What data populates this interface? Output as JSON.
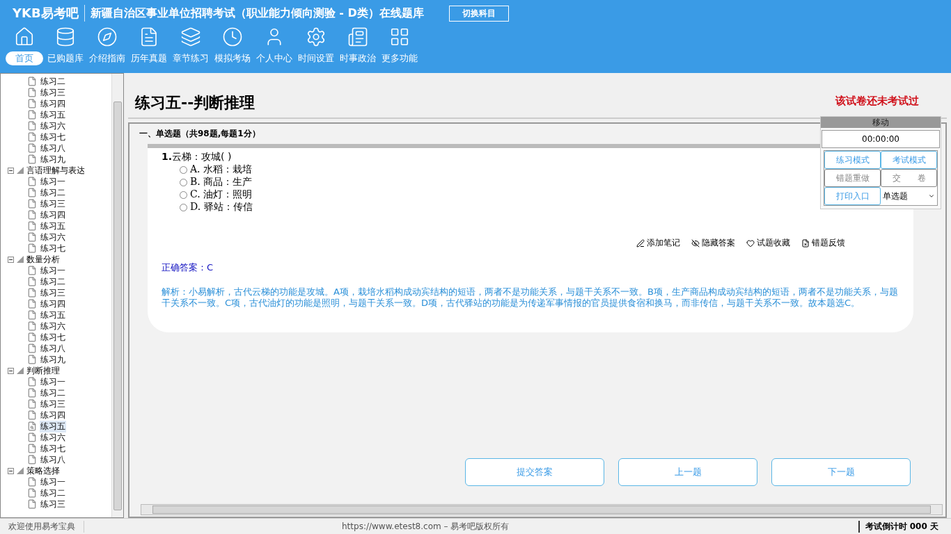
{
  "header": {
    "logo": "YKB易考吧",
    "title": "新疆自治区事业单位招聘考试（职业能力倾向测验 - D类）在线题库",
    "switch_button": "切换科目"
  },
  "nav": [
    {
      "label": "首页",
      "selected": true
    },
    {
      "label": "已购题库",
      "selected": false
    },
    {
      "label": "介绍指南",
      "selected": false
    },
    {
      "label": "历年真题",
      "selected": false
    },
    {
      "label": "章节练习",
      "selected": false
    },
    {
      "label": "模拟考场",
      "selected": false
    },
    {
      "label": "个人中心",
      "selected": false
    },
    {
      "label": "时间设置",
      "selected": false
    },
    {
      "label": "时事政治",
      "selected": false
    },
    {
      "label": "更多功能",
      "selected": false
    }
  ],
  "tree": {
    "leading_items": [
      {
        "label": "练习二",
        "selected": false
      },
      {
        "label": "练习三",
        "selected": false
      },
      {
        "label": "练习四",
        "selected": false
      },
      {
        "label": "练习五",
        "selected": false
      },
      {
        "label": "练习六",
        "selected": false
      },
      {
        "label": "练习七",
        "selected": false
      },
      {
        "label": "练习八",
        "selected": false
      },
      {
        "label": "练习九",
        "selected": false
      }
    ],
    "groups": [
      {
        "label": "言语理解与表达",
        "expanded": true,
        "children": [
          {
            "label": "练习一",
            "selected": false
          },
          {
            "label": "练习二",
            "selected": false
          },
          {
            "label": "练习三",
            "selected": false
          },
          {
            "label": "练习四",
            "selected": false
          },
          {
            "label": "练习五",
            "selected": false
          },
          {
            "label": "练习六",
            "selected": false
          },
          {
            "label": "练习七",
            "selected": false
          }
        ]
      },
      {
        "label": "数量分析",
        "expanded": true,
        "children": [
          {
            "label": "练习一",
            "selected": false
          },
          {
            "label": "练习二",
            "selected": false
          },
          {
            "label": "练习三",
            "selected": false
          },
          {
            "label": "练习四",
            "selected": false
          },
          {
            "label": "练习五",
            "selected": false
          },
          {
            "label": "练习六",
            "selected": false
          },
          {
            "label": "练习七",
            "selected": false
          },
          {
            "label": "练习八",
            "selected": false
          },
          {
            "label": "练习九",
            "selected": false
          }
        ]
      },
      {
        "label": "判断推理",
        "expanded": true,
        "children": [
          {
            "label": "练习一",
            "selected": false
          },
          {
            "label": "练习二",
            "selected": false
          },
          {
            "label": "练习三",
            "selected": false
          },
          {
            "label": "练习四",
            "selected": false
          },
          {
            "label": "练习五",
            "selected": true
          },
          {
            "label": "练习六",
            "selected": false
          },
          {
            "label": "练习七",
            "selected": false
          },
          {
            "label": "练习八",
            "selected": false
          }
        ]
      },
      {
        "label": "策略选择",
        "expanded": true,
        "children": [
          {
            "label": "练习一",
            "selected": false
          },
          {
            "label": "练习二",
            "selected": false
          },
          {
            "label": "练习三",
            "selected": false
          }
        ]
      }
    ]
  },
  "page": {
    "title": "练习五--判断推理",
    "exam_status": "该试卷还未考试过",
    "section": "一、单选题（共98题,每题1分）"
  },
  "question": {
    "number": "1.",
    "stem": "云梯：攻城( )",
    "options": [
      {
        "letter": "A.",
        "text": "水稻：栽培",
        "selected": false
      },
      {
        "letter": "B.",
        "text": "商品：生产",
        "selected": false
      },
      {
        "letter": "C.",
        "text": "油灯：照明",
        "selected": false
      },
      {
        "letter": "D.",
        "text": "驿站：传信",
        "selected": false
      }
    ],
    "actions": [
      "添加笔记",
      "隐藏答案",
      "试题收藏",
      "错题反馈"
    ],
    "answer": "正确答案：C",
    "analysis": "解析：小易解析，古代云梯的功能是攻城。A项，栽培水稻构成动宾结构的短语，两者不是功能关系，与题干关系不一致。B项，生产商品构成动宾结构的短语，两者不是功能关系，与题干关系不一致。C项，古代油灯的功能是照明，与题干关系一致。D项，古代驿站的功能是为传递军事情报的官员提供食宿和换马，而非传信，与题干关系不一致。故本题选C。"
  },
  "panel": {
    "header": "移动",
    "timer": "00:00:00",
    "buttons": [
      {
        "label": "练习模式",
        "disabled": false
      },
      {
        "label": "考试模式",
        "disabled": false
      },
      {
        "label": "错题重做",
        "disabled": true
      },
      {
        "label": "交　　卷",
        "disabled": true
      },
      {
        "label": "打印入口",
        "disabled": false
      }
    ],
    "type_select": "单选题"
  },
  "footer_buttons": [
    "提交答案",
    "上一题",
    "下一题"
  ],
  "status_bar": {
    "welcome": "欢迎使用易考宝典",
    "copyright": "https://www.etest8.com – 易考吧版权所有",
    "countdown": "考试倒计时 000 天"
  }
}
